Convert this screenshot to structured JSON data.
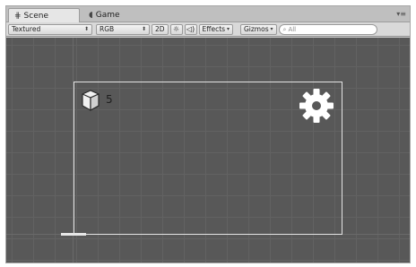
{
  "tabs": [
    {
      "label": "Scene",
      "icon": "grid-icon"
    },
    {
      "label": "Game",
      "icon": "pacman-icon"
    }
  ],
  "toolbar": {
    "shading_mode": "Textured",
    "render_mode": "RGB",
    "toggle_2d": "2D",
    "lighting_icon": "sun-icon",
    "audio_icon": "speaker-icon",
    "effects_label": "Effects",
    "gizmos_label": "Gizmos",
    "search_placeholder": "All"
  },
  "scene": {
    "object_count": "5",
    "object_icon": "cube-icon",
    "settings_icon": "gear-icon"
  }
}
